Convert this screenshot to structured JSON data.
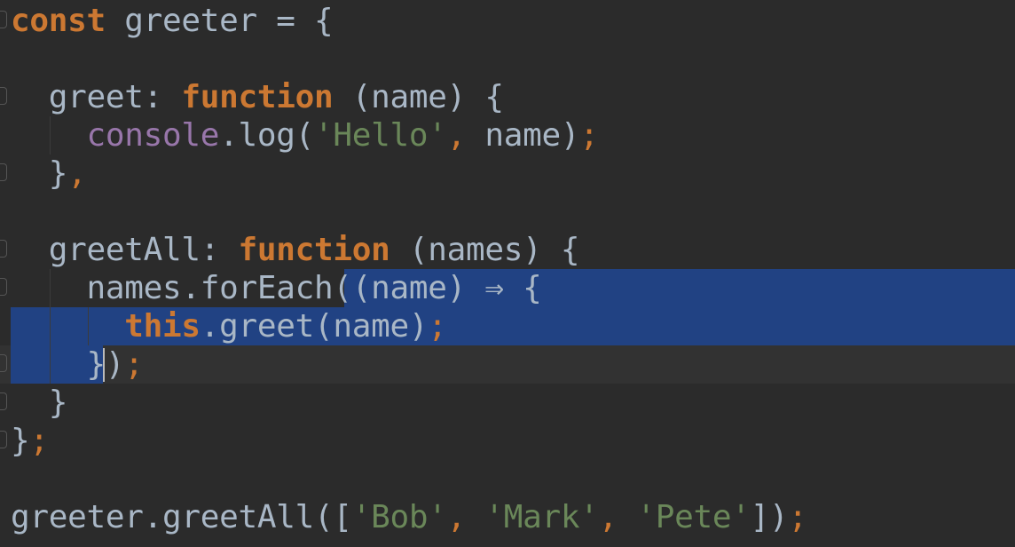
{
  "editor": {
    "code_lines": [
      {
        "tokens": [
          {
            "t": "const",
            "c": "kw"
          },
          {
            "t": " greeter = {",
            "c": "prop"
          }
        ]
      },
      {
        "tokens": []
      },
      {
        "tokens": [
          {
            "t": "  greet",
            "c": "prop"
          },
          {
            "t": ":",
            "c": "prop"
          },
          {
            "t": " function",
            "c": "kw"
          },
          {
            "t": " (name) {",
            "c": "prop"
          }
        ]
      },
      {
        "tokens": [
          {
            "t": "    console",
            "c": "obj"
          },
          {
            "t": ".log(",
            "c": "prop"
          },
          {
            "t": "'Hello'",
            "c": "str"
          },
          {
            "t": ",",
            "c": "punc"
          },
          {
            "t": " name)",
            "c": "prop"
          },
          {
            "t": ";",
            "c": "punc"
          }
        ]
      },
      {
        "tokens": [
          {
            "t": "  }",
            "c": "prop"
          },
          {
            "t": ",",
            "c": "punc"
          }
        ]
      },
      {
        "tokens": []
      },
      {
        "tokens": [
          {
            "t": "  greetAll",
            "c": "prop"
          },
          {
            "t": ":",
            "c": "prop"
          },
          {
            "t": " function",
            "c": "kw"
          },
          {
            "t": " (names) {",
            "c": "prop"
          }
        ]
      },
      {
        "tokens": [
          {
            "t": "    names.forEach(",
            "c": "prop"
          },
          {
            "t": "(name) ⇒ {",
            "c": "prop"
          }
        ]
      },
      {
        "tokens": [
          {
            "t": "      ",
            "c": "prop"
          },
          {
            "t": "this",
            "c": "kw"
          },
          {
            "t": ".greet(name)",
            "c": "prop"
          },
          {
            "t": ";",
            "c": "punc"
          }
        ]
      },
      {
        "tokens": [
          {
            "t": "    })",
            "c": "prop"
          },
          {
            "t": ";",
            "c": "punc"
          }
        ]
      },
      {
        "tokens": [
          {
            "t": "  }",
            "c": "prop"
          }
        ]
      },
      {
        "tokens": [
          {
            "t": "}",
            "c": "prop"
          },
          {
            "t": ";",
            "c": "punc"
          }
        ]
      },
      {
        "tokens": []
      },
      {
        "tokens": [
          {
            "t": "greeter.greetAll([",
            "c": "prop"
          },
          {
            "t": "'Bob'",
            "c": "str"
          },
          {
            "t": ", ",
            "c": "punc"
          },
          {
            "t": "'Mark'",
            "c": "str"
          },
          {
            "t": ", ",
            "c": "punc"
          },
          {
            "t": "'Pete'",
            "c": "str"
          },
          {
            "t": "])",
            "c": "prop"
          },
          {
            "t": ";",
            "c": "punc"
          }
        ]
      }
    ],
    "colors": {
      "background": "#2b2b2b",
      "selection": "#214283",
      "keyword": "#cc7832",
      "string": "#6a8759",
      "default": "#a9b7c6",
      "object": "#9876aa"
    }
  }
}
